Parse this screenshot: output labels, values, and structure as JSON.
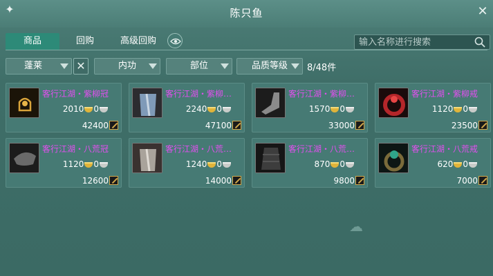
{
  "window": {
    "title": "陈只鱼"
  },
  "tabs": [
    {
      "label": "商品",
      "active": true
    },
    {
      "label": "回购",
      "active": false
    },
    {
      "label": "高级回购",
      "active": false
    }
  ],
  "search": {
    "placeholder": "输入名称进行搜索",
    "value": ""
  },
  "filters": {
    "school": "蓬莱",
    "category": "内功",
    "slot": "部位",
    "quality": "品质等级",
    "count": "8/48件"
  },
  "items": [
    {
      "name": "客行江湖・紫柳冠",
      "gold": "2010",
      "silver": "0",
      "value": "42400",
      "icon": "crown-icon"
    },
    {
      "name": "客行江湖・紫柳…",
      "gold": "2240",
      "silver": "0",
      "value": "47100",
      "icon": "robe-icon"
    },
    {
      "name": "客行江湖・紫柳…",
      "gold": "1570",
      "silver": "0",
      "value": "33000",
      "icon": "boots-icon"
    },
    {
      "name": "客行江湖・紫柳戒",
      "gold": "1120",
      "silver": "0",
      "value": "23500",
      "icon": "ring-icon"
    },
    {
      "name": "客行江湖・八荒冠",
      "gold": "1120",
      "silver": "0",
      "value": "12600",
      "icon": "hat-icon"
    },
    {
      "name": "客行江湖・八荒…",
      "gold": "1240",
      "silver": "0",
      "value": "14000",
      "icon": "robe-icon"
    },
    {
      "name": "客行江湖・八荒…",
      "gold": "870",
      "silver": "0",
      "value": "9800",
      "icon": "bracer-icon"
    },
    {
      "name": "客行江湖・八荒戒",
      "gold": "620",
      "silver": "0",
      "value": "7000",
      "icon": "ring-icon"
    }
  ]
}
